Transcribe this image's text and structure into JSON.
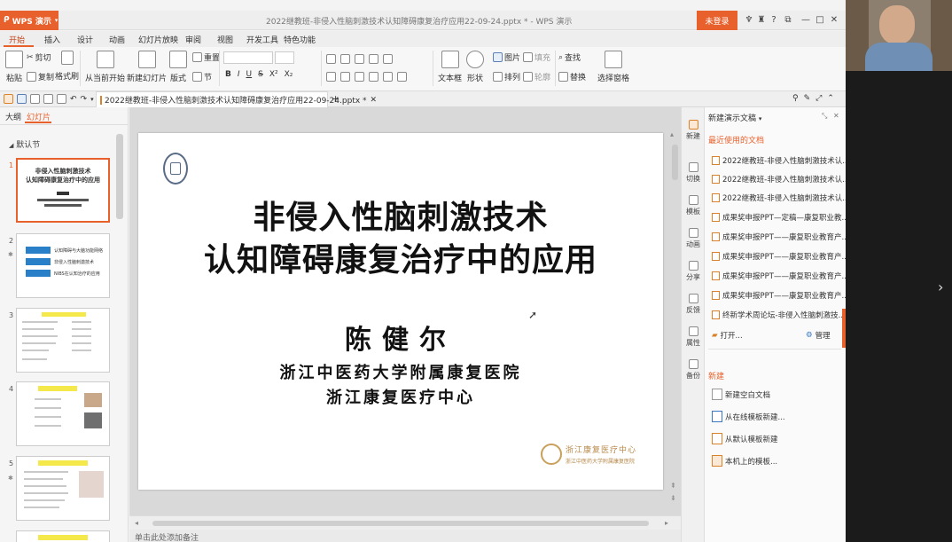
{
  "titlebar": {
    "app_name": "WPS 演示",
    "window_title": "2022继教班-非侵入性脑刺激技术认知障碍康复治疗应用22-09-24.pptx * - WPS 演示",
    "login_label": "未登录",
    "ctrl_help": "?",
    "ctrl_min": "—",
    "ctrl_max": "□",
    "ctrl_close": "✕"
  },
  "menu": {
    "tabs": [
      "开始",
      "插入",
      "设计",
      "动画",
      "幻灯片放映",
      "审阅",
      "视图",
      "开发工具",
      "特色功能"
    ]
  },
  "ribbon": {
    "paste": "粘贴",
    "cut": "剪切",
    "copy": "复制",
    "format_painter": "格式刷",
    "from_current": "从当前开始",
    "new_slide": "新建幻灯片",
    "layout": "版式",
    "section": "节",
    "reset": "重置",
    "bold": "B",
    "italic": "I",
    "underline": "U",
    "strike": "S",
    "textbox": "文本框",
    "shape": "形状",
    "picture": "图片",
    "fill": "填充",
    "arrange": "排列",
    "outline": "轮廓",
    "find": "查找",
    "replace": "替换",
    "select_pane": "选择窗格"
  },
  "doc_tab": {
    "name": "2022继教班-非侵入性脑刺激技术认知障碍康复治疗应用22-09-24.pptx *",
    "close": "✕",
    "add": "+"
  },
  "left_panel": {
    "tab_outline": "大纲",
    "tab_slides": "幻灯片",
    "section_label": "默认节",
    "slides": [
      {
        "num": "1",
        "title_line1": "非侵入性脑刺激技术",
        "title_line2": "认知障碍康复治疗中的应用"
      },
      {
        "num": "2",
        "items": [
          "认知障碍与大脑功能网络",
          "非侵入性脑刺激技术",
          "NIBS在认知治疗的应用"
        ]
      },
      {
        "num": "3"
      },
      {
        "num": "4"
      },
      {
        "num": "5"
      }
    ]
  },
  "slide": {
    "title_line1": "非侵入性脑刺激技术",
    "title_line2": "认知障碍康复治疗中的应用",
    "author": "陈健尔",
    "institution1": "浙江中医药大学附属康复医院",
    "institution2": "浙江康复医疗中心",
    "logo_text": "浙江康复医疗中心",
    "logo_subtext": "浙江中医药大学附属康复医院"
  },
  "right_bar": {
    "items": [
      "新建",
      "切换",
      "模板",
      "动画",
      "分享",
      "反馈",
      "属性",
      "备份"
    ]
  },
  "task_pane": {
    "title": "新建演示文稿",
    "recent_header": "最近使用的文档",
    "recent_docs": [
      "2022继教班-非侵入性脑刺激技术认...",
      "2022继教班-非侵入性脑刺激技术认...",
      "2022继教班-非侵入性脑刺激技术认...",
      "成果奖申报PPT—定稿—康复职业教...",
      "成果奖申报PPT——康复职业教育产...",
      "成果奖申报PPT——康复职业教育产...",
      "成果奖申报PPT——康复职业教育产...",
      "成果奖申报PPT——康复职业教育产...",
      "终新学术周论坛-非侵入性脑刺激技..."
    ],
    "open_label": "打开...",
    "manage_label": "管理",
    "new_header": "新建",
    "new_items": [
      "新建空白文档",
      "从在线模板新建...",
      "从默认模板新建",
      "本机上的模板..."
    ]
  },
  "status": {
    "notes_placeholder": "单击此处添加备注"
  },
  "colors": {
    "accent": "#e8612c",
    "selected_border": "#e8612c"
  }
}
